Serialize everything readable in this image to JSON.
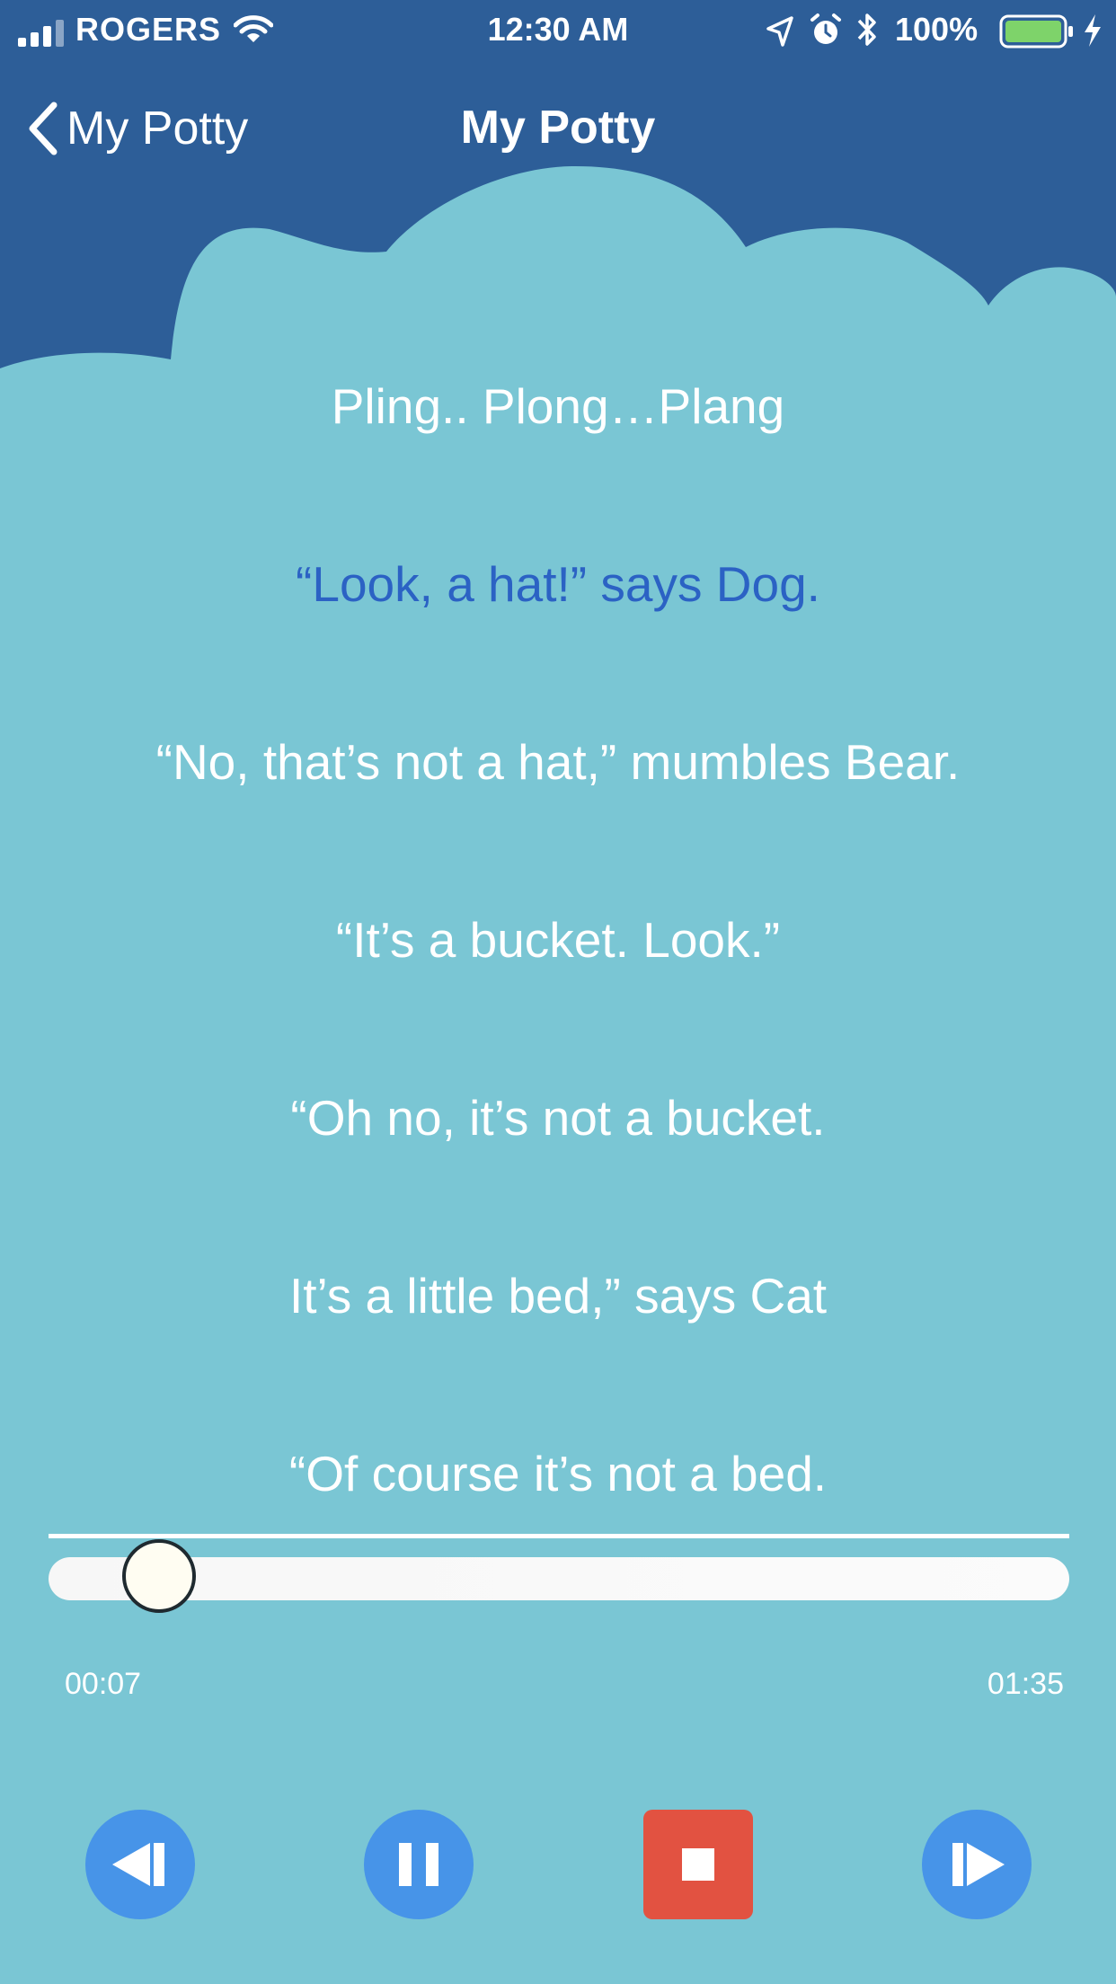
{
  "status": {
    "carrier": "ROGERS",
    "time": "12:30 AM",
    "battery": "100%"
  },
  "nav": {
    "back_label": "My Potty",
    "title": "My Potty"
  },
  "lyrics": [
    {
      "text": "Pling.. Plong…Plang",
      "active": false
    },
    {
      "text": "“Look, a hat!” says Dog.",
      "active": true
    },
    {
      "text": "“No, that’s not a hat,” mumbles Bear.",
      "active": false
    },
    {
      "text": "“It’s a bucket. Look.”",
      "active": false
    },
    {
      "text": "“Oh no, it’s not a bucket.",
      "active": false
    },
    {
      "text": "It’s a little bed,” says Cat",
      "active": false
    },
    {
      "text": "“Of course it’s not a bed.",
      "active": false
    }
  ],
  "player": {
    "elapsed": "00:07",
    "total": "01:35",
    "progress_fraction": 0.07
  },
  "controls": [
    {
      "name": "rewind-button",
      "icon": "skip-back-icon"
    },
    {
      "name": "pause-button",
      "icon": "pause-icon"
    },
    {
      "name": "stop-button",
      "icon": "stop-icon"
    },
    {
      "name": "forward-button",
      "icon": "skip-forward-icon"
    }
  ],
  "colors": {
    "header": "#2D5E98",
    "cloud": "#7AC6D4",
    "active_lyric": "#2B62C4",
    "control_blue": "#4794E8",
    "control_red": "#E25241",
    "battery_green": "#7ED36A"
  }
}
